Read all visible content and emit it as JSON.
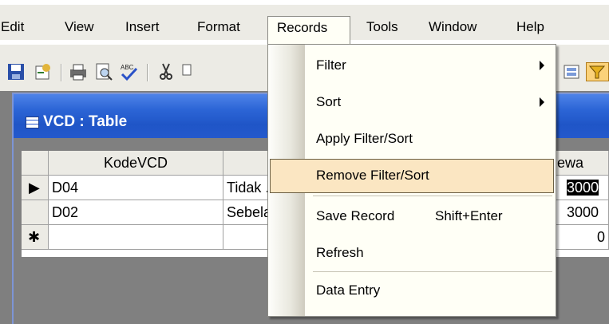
{
  "menubar": {
    "items": [
      {
        "label": "Edit"
      },
      {
        "label": "View"
      },
      {
        "label": "Insert"
      },
      {
        "label": "Format"
      },
      {
        "label": "Records"
      },
      {
        "label": "Tools"
      },
      {
        "label": "Window"
      },
      {
        "label": "Help"
      }
    ]
  },
  "toolbar": {
    "icons": [
      "save-icon",
      "database-icon",
      "print-icon",
      "print-preview-icon",
      "spelling-icon",
      "cut-icon",
      "copy-icon",
      "toggle-icon",
      "filter-icon"
    ]
  },
  "table_window": {
    "title": "VCD : Table",
    "columns": [
      "KodeVCD",
      "",
      "ewa"
    ],
    "rows": [
      {
        "selector": "▶",
        "cells": [
          "D04",
          "Tidak .",
          "3000"
        ]
      },
      {
        "selector": "",
        "cells": [
          "D02",
          "Sebela",
          "3000"
        ]
      },
      {
        "selector": "✱",
        "cells": [
          "",
          "",
          "0"
        ]
      }
    ]
  },
  "records_menu": {
    "items": [
      {
        "label": "Filter",
        "has_submenu": true
      },
      {
        "label": "Sort",
        "has_submenu": true
      },
      {
        "label": "Apply Filter/Sort"
      },
      {
        "label": "Remove Filter/Sort",
        "highlighted": true
      },
      {
        "label": "Save Record",
        "shortcut": "Shift+Enter"
      },
      {
        "label": "Refresh"
      },
      {
        "label": "Data Entry"
      }
    ]
  },
  "colors": {
    "titlebar": "#2c65d6",
    "highlight": "#fbe6c2",
    "menu_bg": "#fffff6",
    "chrome": "#ecebe5"
  }
}
